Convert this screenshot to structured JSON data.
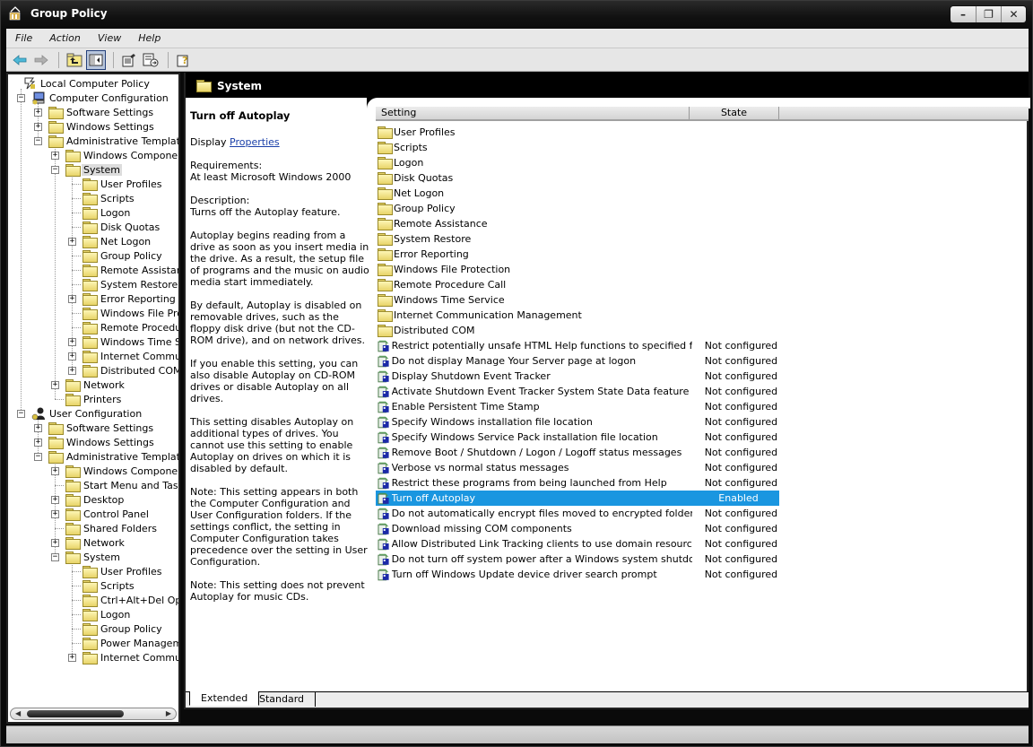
{
  "window": {
    "title": "Group Policy",
    "controls": {
      "minimize": "–",
      "restore": "❐",
      "close": "✕"
    }
  },
  "menu": [
    "File",
    "Action",
    "View",
    "Help"
  ],
  "toolbar": {
    "buttons": [
      "back",
      "forward",
      "up-one-level",
      "show-hide-console-tree",
      "properties",
      "export-list",
      "help"
    ]
  },
  "tree": {
    "items": [
      {
        "label": "Local Computer Policy",
        "depth": 0,
        "icon": "policy-root-icon",
        "expander": ""
      },
      {
        "label": "Computer Configuration",
        "depth": 1,
        "icon": "computer-icon",
        "expander": "−"
      },
      {
        "label": "Software Settings",
        "depth": 2,
        "icon": "folder-icon",
        "expander": "+"
      },
      {
        "label": "Windows Settings",
        "depth": 2,
        "icon": "folder-icon",
        "expander": "+"
      },
      {
        "label": "Administrative Templates",
        "depth": 2,
        "icon": "folder-icon",
        "expander": "−"
      },
      {
        "label": "Windows Components",
        "depth": 3,
        "icon": "folder-icon",
        "expander": "+"
      },
      {
        "label": "System",
        "depth": 3,
        "icon": "folder-open-icon",
        "expander": "−",
        "selected": true
      },
      {
        "label": "User Profiles",
        "depth": 4,
        "icon": "folder-icon",
        "expander": ""
      },
      {
        "label": "Scripts",
        "depth": 4,
        "icon": "folder-icon",
        "expander": ""
      },
      {
        "label": "Logon",
        "depth": 4,
        "icon": "folder-icon",
        "expander": ""
      },
      {
        "label": "Disk Quotas",
        "depth": 4,
        "icon": "folder-icon",
        "expander": ""
      },
      {
        "label": "Net Logon",
        "depth": 4,
        "icon": "folder-icon",
        "expander": "+"
      },
      {
        "label": "Group Policy",
        "depth": 4,
        "icon": "folder-icon",
        "expander": ""
      },
      {
        "label": "Remote Assistance",
        "depth": 4,
        "icon": "folder-icon",
        "expander": ""
      },
      {
        "label": "System Restore",
        "depth": 4,
        "icon": "folder-icon",
        "expander": ""
      },
      {
        "label": "Error Reporting",
        "depth": 4,
        "icon": "folder-icon",
        "expander": "+"
      },
      {
        "label": "Windows File Protection",
        "depth": 4,
        "icon": "folder-icon",
        "expander": ""
      },
      {
        "label": "Remote Procedure Call",
        "depth": 4,
        "icon": "folder-icon",
        "expander": ""
      },
      {
        "label": "Windows Time Service",
        "depth": 4,
        "icon": "folder-icon",
        "expander": "+"
      },
      {
        "label": "Internet Communication Management",
        "depth": 4,
        "icon": "folder-icon",
        "expander": "+"
      },
      {
        "label": "Distributed COM",
        "depth": 4,
        "icon": "folder-icon",
        "expander": "+"
      },
      {
        "label": "Network",
        "depth": 3,
        "icon": "folder-icon",
        "expander": "+"
      },
      {
        "label": "Printers",
        "depth": 3,
        "icon": "folder-icon",
        "expander": ""
      },
      {
        "label": "User Configuration",
        "depth": 1,
        "icon": "user-icon",
        "expander": "−"
      },
      {
        "label": "Software Settings",
        "depth": 2,
        "icon": "folder-icon",
        "expander": "+"
      },
      {
        "label": "Windows Settings",
        "depth": 2,
        "icon": "folder-icon",
        "expander": "+"
      },
      {
        "label": "Administrative Templates",
        "depth": 2,
        "icon": "folder-icon",
        "expander": "−"
      },
      {
        "label": "Windows Components",
        "depth": 3,
        "icon": "folder-icon",
        "expander": "+"
      },
      {
        "label": "Start Menu and Taskbar",
        "depth": 3,
        "icon": "folder-icon",
        "expander": ""
      },
      {
        "label": "Desktop",
        "depth": 3,
        "icon": "folder-icon",
        "expander": "+"
      },
      {
        "label": "Control Panel",
        "depth": 3,
        "icon": "folder-icon",
        "expander": "+"
      },
      {
        "label": "Shared Folders",
        "depth": 3,
        "icon": "folder-icon",
        "expander": ""
      },
      {
        "label": "Network",
        "depth": 3,
        "icon": "folder-icon",
        "expander": "+"
      },
      {
        "label": "System",
        "depth": 3,
        "icon": "folder-icon",
        "expander": "−"
      },
      {
        "label": "User Profiles",
        "depth": 4,
        "icon": "folder-icon",
        "expander": ""
      },
      {
        "label": "Scripts",
        "depth": 4,
        "icon": "folder-icon",
        "expander": ""
      },
      {
        "label": "Ctrl+Alt+Del Options",
        "depth": 4,
        "icon": "folder-icon",
        "expander": ""
      },
      {
        "label": "Logon",
        "depth": 4,
        "icon": "folder-icon",
        "expander": ""
      },
      {
        "label": "Group Policy",
        "depth": 4,
        "icon": "folder-icon",
        "expander": ""
      },
      {
        "label": "Power Management",
        "depth": 4,
        "icon": "folder-icon",
        "expander": ""
      },
      {
        "label": "Internet Communication Management",
        "depth": 4,
        "icon": "folder-icon",
        "expander": "+"
      }
    ]
  },
  "details": {
    "header_title": "System",
    "title": "Turn off Autoplay",
    "display_prefix": "Display ",
    "display_link": "Properties",
    "requirements_label": "Requirements:",
    "requirements_value": "At least Microsoft Windows 2000",
    "description_label": "Description:",
    "description_summary": "Turns off the Autoplay feature.",
    "paragraphs": [
      "Autoplay begins reading from a drive as soon as you insert media in the drive. As a result, the setup file of programs and the music on audio media start immediately.",
      "By default, Autoplay is disabled on removable drives, such as the floppy disk drive (but not the CD-ROM drive), and on network drives.",
      "If you enable this setting, you can also disable Autoplay on CD-ROM drives or disable Autoplay on all drives.",
      "This setting disables Autoplay on additional types of drives. You cannot use this setting to enable Autoplay on drives on which it is disabled by default.",
      "Note: This setting appears in both the Computer Configuration and User Configuration folders. If the settings conflict, the setting in Computer Configuration takes precedence over the setting in User Configuration.",
      "Note: This setting does not prevent Autoplay for music CDs."
    ]
  },
  "list": {
    "columns": {
      "setting": "Setting",
      "state": "State"
    },
    "rows": [
      {
        "name": "User Profiles",
        "state": "",
        "type": "folder"
      },
      {
        "name": "Scripts",
        "state": "",
        "type": "folder"
      },
      {
        "name": "Logon",
        "state": "",
        "type": "folder"
      },
      {
        "name": "Disk Quotas",
        "state": "",
        "type": "folder"
      },
      {
        "name": "Net Logon",
        "state": "",
        "type": "folder"
      },
      {
        "name": "Group Policy",
        "state": "",
        "type": "folder"
      },
      {
        "name": "Remote Assistance",
        "state": "",
        "type": "folder"
      },
      {
        "name": "System Restore",
        "state": "",
        "type": "folder"
      },
      {
        "name": "Error Reporting",
        "state": "",
        "type": "folder"
      },
      {
        "name": "Windows File Protection",
        "state": "",
        "type": "folder"
      },
      {
        "name": "Remote Procedure Call",
        "state": "",
        "type": "folder"
      },
      {
        "name": "Windows Time Service",
        "state": "",
        "type": "folder"
      },
      {
        "name": "Internet Communication Management",
        "state": "",
        "type": "folder"
      },
      {
        "name": "Distributed COM",
        "state": "",
        "type": "folder"
      },
      {
        "name": "Restrict potentially unsafe HTML Help functions to specified folders",
        "state": "Not configured",
        "type": "policy"
      },
      {
        "name": "Do not display Manage Your Server page at logon",
        "state": "Not configured",
        "type": "policy"
      },
      {
        "name": "Display Shutdown Event Tracker",
        "state": "Not configured",
        "type": "policy"
      },
      {
        "name": "Activate Shutdown Event Tracker System State Data feature",
        "state": "Not configured",
        "type": "policy"
      },
      {
        "name": "Enable Persistent Time Stamp",
        "state": "Not configured",
        "type": "policy"
      },
      {
        "name": "Specify Windows installation file location",
        "state": "Not configured",
        "type": "policy"
      },
      {
        "name": "Specify Windows Service Pack installation file location",
        "state": "Not configured",
        "type": "policy"
      },
      {
        "name": "Remove Boot / Shutdown / Logon / Logoff status messages",
        "state": "Not configured",
        "type": "policy"
      },
      {
        "name": "Verbose vs normal status messages",
        "state": "Not configured",
        "type": "policy"
      },
      {
        "name": "Restrict these programs from being launched from Help",
        "state": "Not configured",
        "type": "policy"
      },
      {
        "name": "Turn off Autoplay",
        "state": "Enabled",
        "type": "policy",
        "selected": true
      },
      {
        "name": "Do not automatically encrypt files moved to encrypted folders",
        "state": "Not configured",
        "type": "policy"
      },
      {
        "name": "Download missing COM components",
        "state": "Not configured",
        "type": "policy"
      },
      {
        "name": "Allow Distributed Link Tracking clients to use domain resources",
        "state": "Not configured",
        "type": "policy"
      },
      {
        "name": "Do not turn off system power after a Windows system shutdown ...",
        "state": "Not configured",
        "type": "policy"
      },
      {
        "name": "Turn off Windows Update device driver search prompt",
        "state": "Not configured",
        "type": "policy"
      }
    ]
  },
  "tabs": [
    {
      "label": "Extended",
      "active": true
    },
    {
      "label": "Standard",
      "active": false
    }
  ],
  "colors": {
    "selection": "#1a96e0",
    "header_bg": "#000000",
    "link": "#1a3fa8"
  }
}
